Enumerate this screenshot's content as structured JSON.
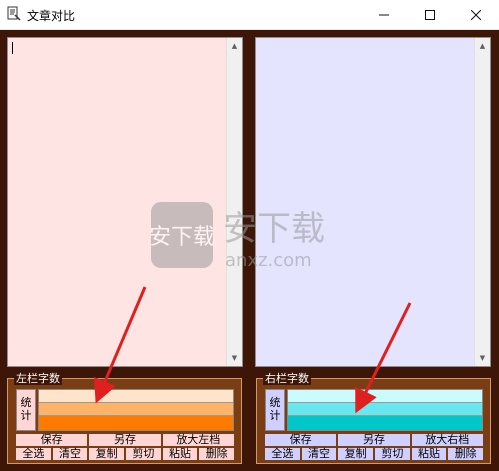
{
  "window": {
    "title": "文章对比",
    "icons": {
      "app": "document-compare-icon",
      "minimize": "minimize-icon",
      "maximize": "maximize-icon",
      "close": "close-icon"
    }
  },
  "left": {
    "text": "",
    "stats_label": "左栏字数",
    "count_label": "统计",
    "bar_colors": [
      "#ffe4cc",
      "#ffb366",
      "#ff7a00"
    ],
    "buttons_row1": [
      "保存",
      "另存",
      "放大左档"
    ],
    "buttons_row2": [
      "全选",
      "清空",
      "复制",
      "剪切",
      "粘贴",
      "删除"
    ]
  },
  "right": {
    "text": "",
    "stats_label": "右栏字数",
    "count_label": "统计",
    "bar_colors": [
      "#ccfbff",
      "#66e8ee",
      "#00c8c8"
    ],
    "buttons_row1": [
      "保存",
      "另存",
      "放大右档"
    ],
    "buttons_row2": [
      "全选",
      "清空",
      "复制",
      "剪切",
      "粘贴",
      "删除"
    ]
  },
  "watermark": {
    "brand": "安下载",
    "domain": "anxz.com"
  },
  "colors": {
    "frame": "#3d1608",
    "stats_bg": "#7b3d13",
    "arrow": "#e01f1f"
  }
}
